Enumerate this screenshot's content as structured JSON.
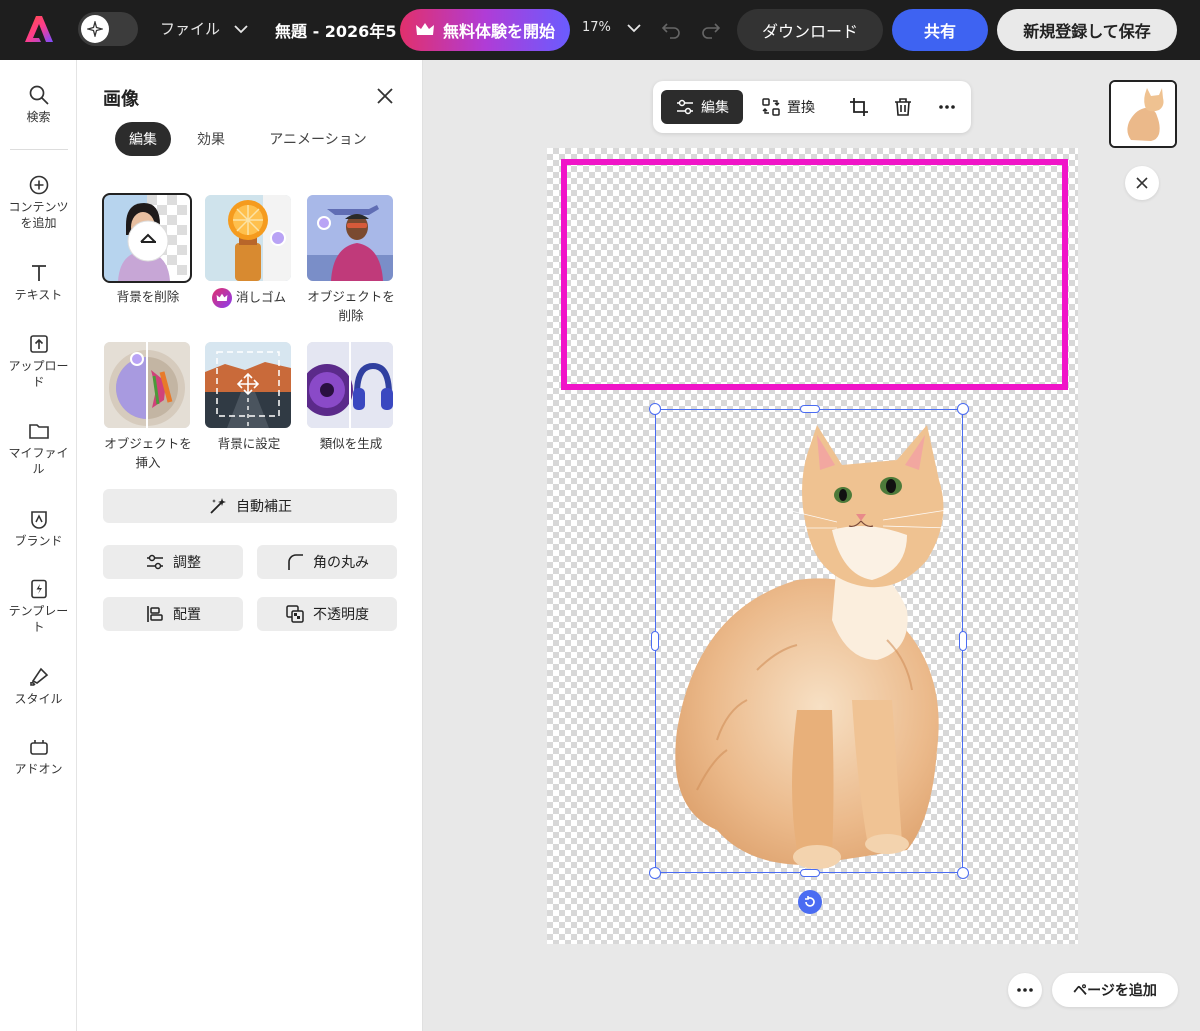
{
  "topbar": {
    "file_menu": "ファイル",
    "doc_title": "無題 - 2026年5",
    "trial_label": "無料体験を開始",
    "zoom_level": "17%",
    "download_label": "ダウンロード",
    "share_label": "共有",
    "signup_label": "新規登録して保存"
  },
  "rail": {
    "items": [
      {
        "label": "検索",
        "icon": "search-icon"
      },
      {
        "label": "コンテンツを追加",
        "icon": "plus-circle-icon"
      },
      {
        "label": "テキスト",
        "icon": "text-icon"
      },
      {
        "label": "アップロード",
        "icon": "upload-icon"
      },
      {
        "label": "マイファイル",
        "icon": "folder-icon"
      },
      {
        "label": "ブランド",
        "icon": "brand-icon"
      },
      {
        "label": "テンプレート",
        "icon": "template-icon"
      },
      {
        "label": "スタイル",
        "icon": "style-icon"
      },
      {
        "label": "アドオン",
        "icon": "addon-icon"
      }
    ]
  },
  "panel": {
    "title": "画像",
    "tabs": [
      "編集",
      "効果",
      "アニメーション"
    ],
    "tools": [
      {
        "label": "背景を削除"
      },
      {
        "label": "消しゴム"
      },
      {
        "label": "オブジェクトを削除"
      },
      {
        "label": "オブジェクトを挿入"
      },
      {
        "label": "背景に設定"
      },
      {
        "label": "類似を生成"
      }
    ],
    "auto_fix": "自動補正",
    "adjust": "調整",
    "round_corners": "角の丸み",
    "arrange": "配置",
    "opacity": "不透明度"
  },
  "canvas": {
    "toolbar": {
      "edit_label": "編集",
      "replace_label": "置換"
    },
    "add_page_label": "ページを追加"
  },
  "colors": {
    "accent_blue": "#3e63f2",
    "selection_blue": "#4a6cf2",
    "pink_frame": "#f014c8",
    "topbar_bg": "#1e1e1e"
  }
}
